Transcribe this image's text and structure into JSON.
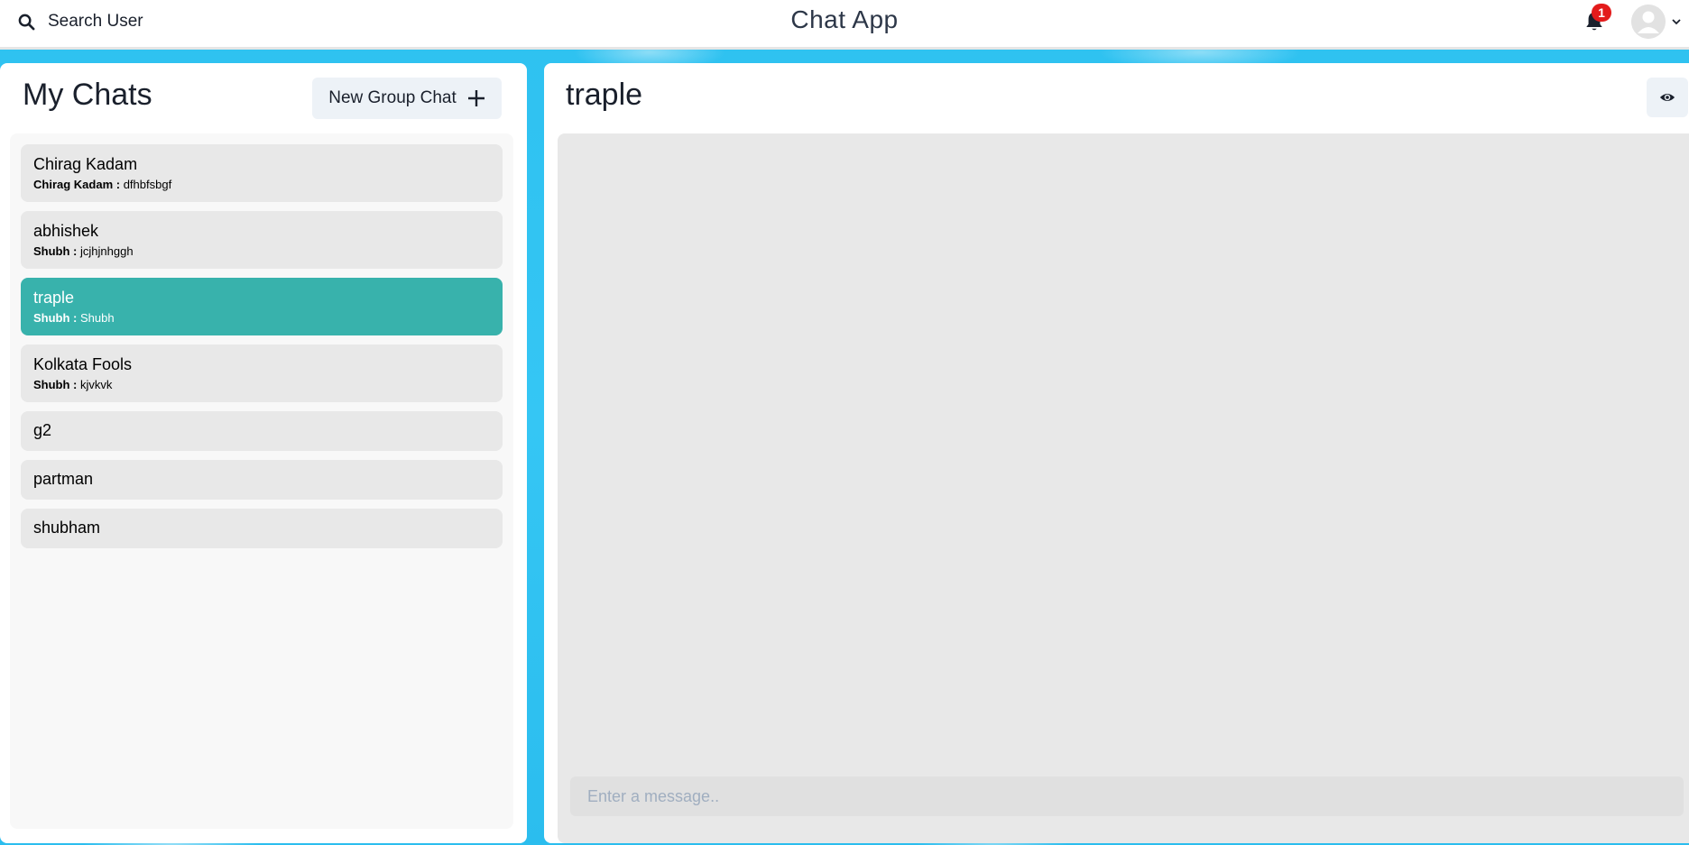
{
  "header": {
    "search_label": "Search User",
    "app_title": "Chat App",
    "notification_count": "1"
  },
  "sidebar": {
    "title": "My Chats",
    "new_group_label": "New Group Chat",
    "chats": [
      {
        "name": "Chirag Kadam",
        "sender": "Chirag Kadam :",
        "message": "dfhbfsbgf"
      },
      {
        "name": "abhishek",
        "sender": "Shubh :",
        "message": "jcjhjnhggh"
      },
      {
        "name": "traple",
        "sender": "Shubh :",
        "message": "Shubh"
      },
      {
        "name": "Kolkata Fools",
        "sender": "Shubh :",
        "message": "kjvkvk"
      },
      {
        "name": "g2"
      },
      {
        "name": "partman"
      },
      {
        "name": "shubham"
      }
    ]
  },
  "chat": {
    "title": "traple",
    "input_placeholder": "Enter a message.."
  },
  "colors": {
    "accent": "#38b2ac",
    "badge": "#e31b1b",
    "background": "#35c6f4"
  },
  "icons": {
    "search": "search-icon",
    "bell": "bell-icon",
    "avatar": "avatar-icon",
    "chevron": "chevron-down-icon",
    "add": "plus-icon",
    "view": "eye-icon"
  }
}
